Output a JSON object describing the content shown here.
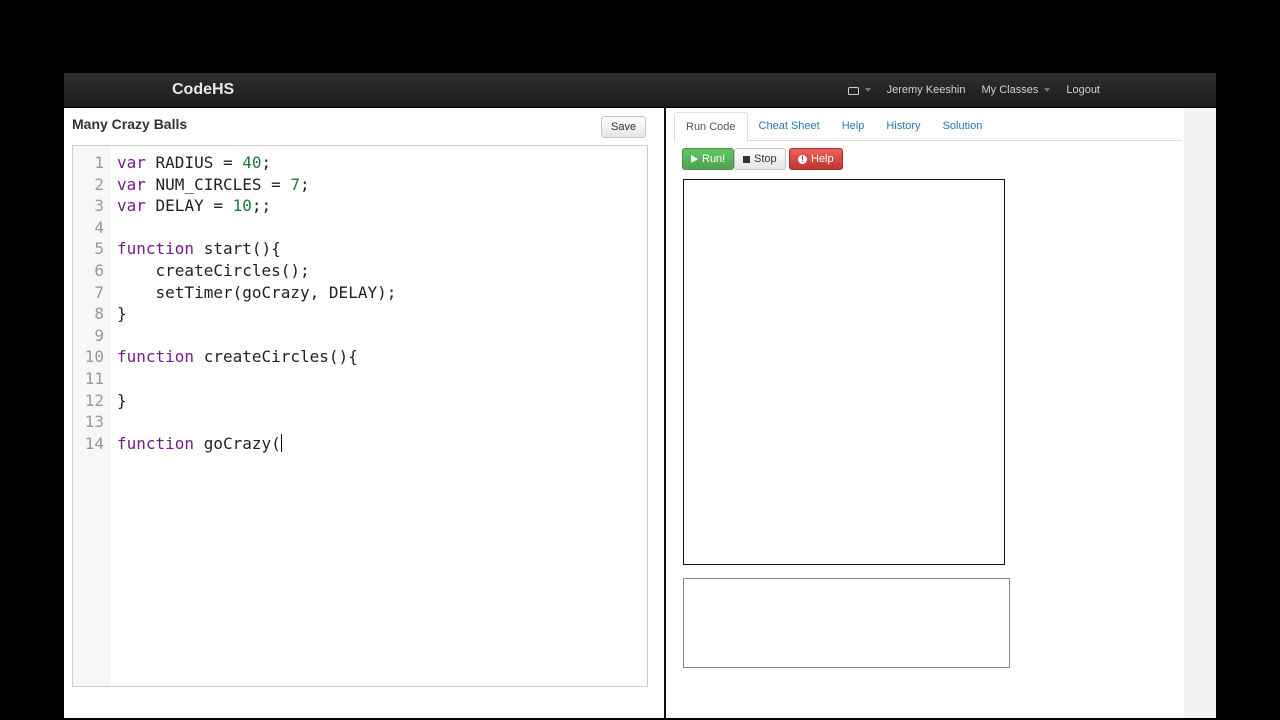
{
  "navbar": {
    "brand": "CodeHS",
    "user_name": "Jeremy Keeshin",
    "my_classes": "My Classes",
    "logout": "Logout"
  },
  "editor": {
    "program_title": "Many Crazy Balls",
    "save_label": "Save",
    "lines": [
      {
        "n": "1",
        "tokens": [
          {
            "t": "var",
            "c": "kw"
          },
          {
            "t": " RADIUS = ",
            "c": "plain"
          },
          {
            "t": "40",
            "c": "num"
          },
          {
            "t": ";",
            "c": "plain"
          }
        ]
      },
      {
        "n": "2",
        "tokens": [
          {
            "t": "var",
            "c": "kw"
          },
          {
            "t": " NUM_CIRCLES = ",
            "c": "plain"
          },
          {
            "t": "7",
            "c": "num"
          },
          {
            "t": ";",
            "c": "plain"
          }
        ]
      },
      {
        "n": "3",
        "tokens": [
          {
            "t": "var",
            "c": "kw"
          },
          {
            "t": " DELAY = ",
            "c": "plain"
          },
          {
            "t": "10",
            "c": "num"
          },
          {
            "t": ";;",
            "c": "plain"
          }
        ]
      },
      {
        "n": "4",
        "tokens": []
      },
      {
        "n": "5",
        "tokens": [
          {
            "t": "function",
            "c": "kw"
          },
          {
            "t": " start(){",
            "c": "plain"
          }
        ]
      },
      {
        "n": "6",
        "tokens": [
          {
            "t": "    createCircles();",
            "c": "plain"
          }
        ]
      },
      {
        "n": "7",
        "tokens": [
          {
            "t": "    setTimer(goCrazy, DELAY);",
            "c": "plain"
          }
        ]
      },
      {
        "n": "8",
        "tokens": [
          {
            "t": "}",
            "c": "plain"
          }
        ]
      },
      {
        "n": "9",
        "tokens": []
      },
      {
        "n": "10",
        "tokens": [
          {
            "t": "function",
            "c": "kw"
          },
          {
            "t": " createCircles(){",
            "c": "plain"
          }
        ]
      },
      {
        "n": "11",
        "tokens": []
      },
      {
        "n": "12",
        "tokens": [
          {
            "t": "}",
            "c": "plain"
          }
        ]
      },
      {
        "n": "13",
        "tokens": []
      },
      {
        "n": "14",
        "tokens": [
          {
            "t": "function",
            "c": "kw"
          },
          {
            "t": " goCrazy(",
            "c": "plain"
          }
        ],
        "cursor": true
      }
    ]
  },
  "right": {
    "tabs": [
      {
        "label": "Run Code",
        "active": true
      },
      {
        "label": "Cheat Sheet",
        "active": false
      },
      {
        "label": "Help",
        "active": false
      },
      {
        "label": "History",
        "active": false
      },
      {
        "label": "Solution",
        "active": false
      }
    ],
    "run_label": "Run!",
    "stop_label": "Stop",
    "help_label": "Help"
  },
  "colors": {
    "keyword": "#7a1a8a",
    "number": "#1e7a3a",
    "run_green": "#51a351",
    "help_red": "#bd362f",
    "link_blue": "#2a7ab0"
  },
  "icons": {
    "inbox": "inbox-icon",
    "run": "play-icon",
    "stop": "stop-icon",
    "help": "alert-icon"
  }
}
